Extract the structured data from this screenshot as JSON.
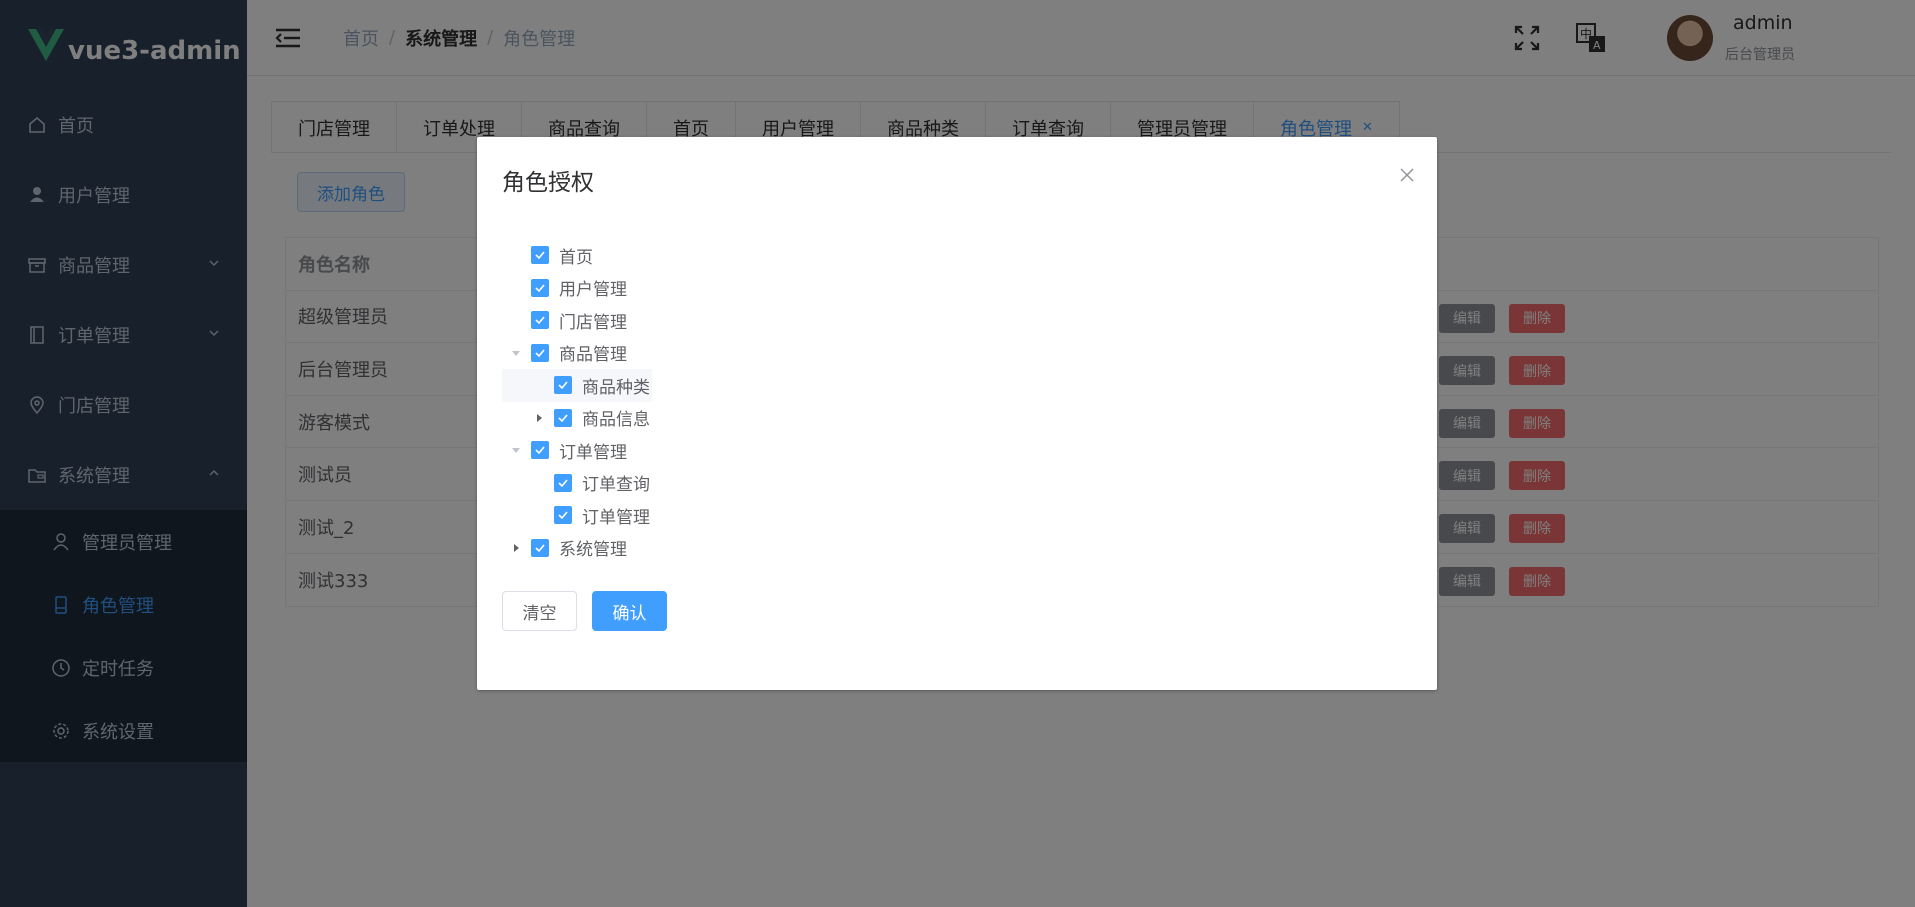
{
  "app": {
    "name": "vue3-admin",
    "brand_color": "#41b883",
    "accent": "#409eff"
  },
  "sidebar": {
    "items": [
      {
        "label": "首页",
        "icon": "home-icon"
      },
      {
        "label": "用户管理",
        "icon": "user-icon"
      },
      {
        "label": "商品管理",
        "icon": "box-icon"
      },
      {
        "label": "订单管理",
        "icon": "document-icon"
      },
      {
        "label": "门店管理",
        "icon": "location-icon"
      },
      {
        "label": "系统管理",
        "icon": "folder-icon"
      }
    ],
    "submenu": [
      {
        "label": "管理员管理",
        "icon": "user-outline-icon"
      },
      {
        "label": "角色管理",
        "icon": "tablet-icon",
        "active": true
      },
      {
        "label": "定时任务",
        "icon": "clock-icon"
      },
      {
        "label": "系统设置",
        "icon": "gear-icon"
      }
    ]
  },
  "header": {
    "breadcrumb": [
      "首页",
      "系统管理",
      "角色管理"
    ],
    "user": {
      "name": "admin",
      "role": "后台管理员"
    }
  },
  "tabs": [
    "门店管理",
    "订单处理",
    "商品查询",
    "首页",
    "用户管理",
    "商品种类",
    "订单查询",
    "管理员管理",
    "角色管理"
  ],
  "main": {
    "add_button": "添加角色",
    "table": {
      "header": "角色名称",
      "rows": [
        "超级管理员",
        "后台管理员",
        "游客模式",
        "测试员",
        "测试_2",
        "测试333"
      ],
      "edit_label": "编辑",
      "delete_label": "删除"
    }
  },
  "dialog": {
    "title": "角色授权",
    "tree": [
      {
        "label": "首页",
        "level": 0,
        "checked": true,
        "expand": "none"
      },
      {
        "label": "用户管理",
        "level": 0,
        "checked": true,
        "expand": "none"
      },
      {
        "label": "门店管理",
        "level": 0,
        "checked": true,
        "expand": "none"
      },
      {
        "label": "商品管理",
        "level": 0,
        "checked": true,
        "expand": "expanded"
      },
      {
        "label": "商品种类",
        "level": 1,
        "checked": true,
        "expand": "none",
        "highlight": true
      },
      {
        "label": "商品信息",
        "level": 1,
        "checked": true,
        "expand": "collapsed"
      },
      {
        "label": "订单管理",
        "level": 0,
        "checked": true,
        "expand": "expanded"
      },
      {
        "label": "订单查询",
        "level": 1,
        "checked": true,
        "expand": "none"
      },
      {
        "label": "订单管理",
        "level": 1,
        "checked": true,
        "expand": "none"
      },
      {
        "label": "系统管理",
        "level": 0,
        "checked": true,
        "expand": "collapsed"
      }
    ],
    "clear_label": "清空",
    "confirm_label": "确认"
  }
}
